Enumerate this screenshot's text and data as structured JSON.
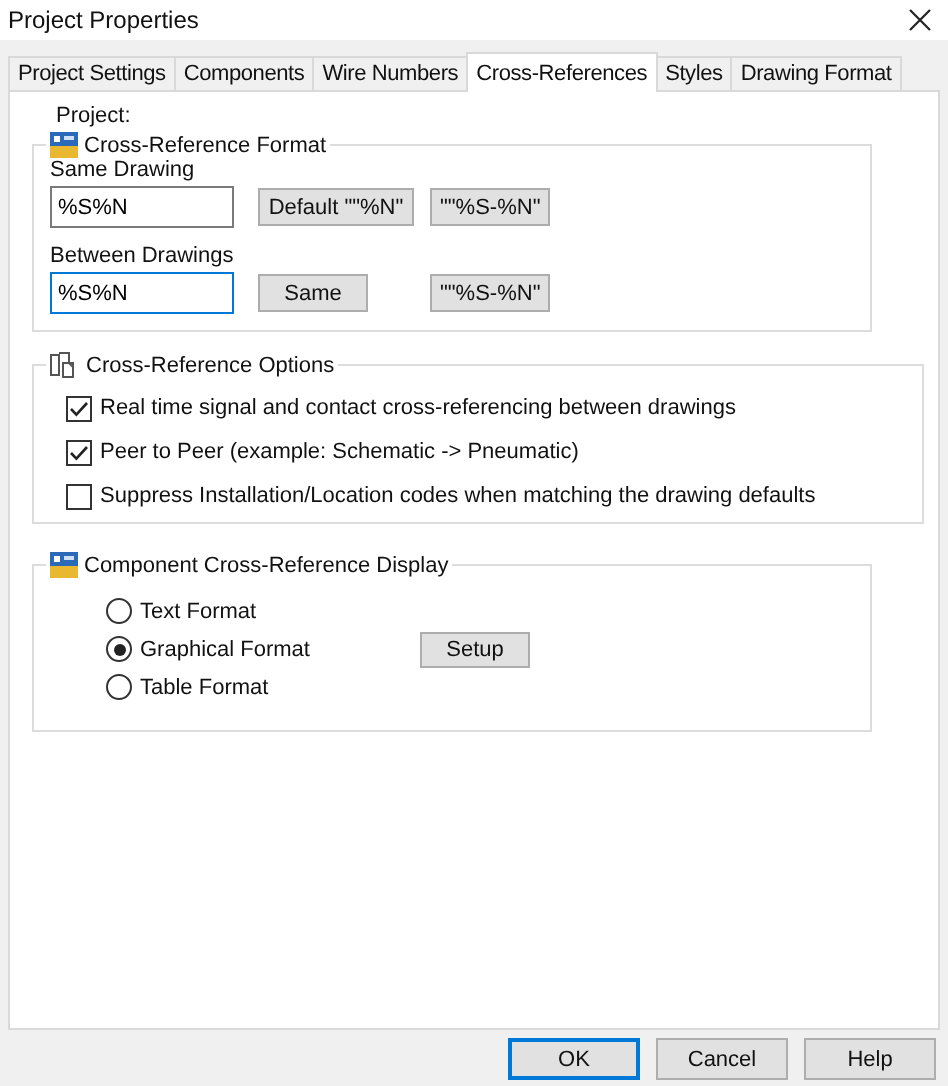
{
  "window": {
    "title": "Project Properties"
  },
  "tabs": [
    {
      "label": "Project Settings",
      "selected": false
    },
    {
      "label": "Components",
      "selected": false
    },
    {
      "label": "Wire Numbers",
      "selected": false
    },
    {
      "label": "Cross-References",
      "selected": true
    },
    {
      "label": "Styles",
      "selected": false
    },
    {
      "label": "Drawing Format",
      "selected": false
    }
  ],
  "project_label": "Project:",
  "format_group": {
    "title": "Cross-Reference Format",
    "rows": [
      {
        "label": "Same Drawing",
        "value": "%S%N",
        "focused": false,
        "buttons": [
          "Default \"\"%N\"",
          "\"\"%S-%N\""
        ]
      },
      {
        "label": "Between Drawings",
        "value": "%S%N",
        "focused": true,
        "buttons": [
          "Same",
          "\"\"%S-%N\""
        ]
      }
    ]
  },
  "options_group": {
    "title": "Cross-Reference Options",
    "checkboxes": [
      {
        "label": "Real time signal and contact cross-referencing between drawings",
        "checked": true
      },
      {
        "label": "Peer to Peer (example: Schematic -> Pneumatic)",
        "checked": true
      },
      {
        "label": "Suppress Installation/Location codes when matching the drawing defaults",
        "checked": false
      }
    ]
  },
  "display_group": {
    "title": "Component Cross-Reference Display",
    "radios": [
      {
        "label": "Text Format",
        "selected": false
      },
      {
        "label": "Graphical Format",
        "selected": true
      },
      {
        "label": "Table Format",
        "selected": false
      }
    ],
    "setup_button": "Setup"
  },
  "buttons": [
    {
      "label": "OK",
      "default": true
    },
    {
      "label": "Cancel",
      "default": false
    },
    {
      "label": "Help",
      "default": false
    }
  ]
}
